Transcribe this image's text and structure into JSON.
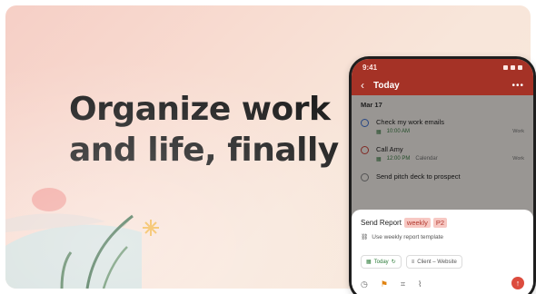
{
  "headline": {
    "line1": "Organize work",
    "line2": "and life, finally"
  },
  "phone": {
    "status_time": "9:41",
    "header": {
      "back_icon": "back-arrow-icon",
      "title": "Today",
      "more_icon": "more-icon"
    },
    "date": "Mar 17",
    "tasks": [
      {
        "name": "Check my work emails",
        "due": "10:00 AM",
        "sub": "",
        "project": "Work"
      },
      {
        "name": "Call Amy",
        "due": "12:00 PM",
        "sub": "Calendar",
        "project": "Work"
      },
      {
        "name": "Send pitch deck to prospect",
        "due": "",
        "sub": "",
        "project": ""
      }
    ],
    "sheet": {
      "title": "Send Report",
      "tag1": "weekly",
      "tag2": "P2",
      "description": "Use weekly report template",
      "chip_today": "Today",
      "chip_project": "Client – Website",
      "icons": [
        "timer-icon",
        "flag-icon",
        "label-icon",
        "attachment-icon"
      ],
      "send_icon": "send-arrow-icon"
    }
  },
  "colors": {
    "brand_red": "#a53226",
    "accent_red": "#dc4c3e",
    "headline": "#1f1f1f"
  }
}
